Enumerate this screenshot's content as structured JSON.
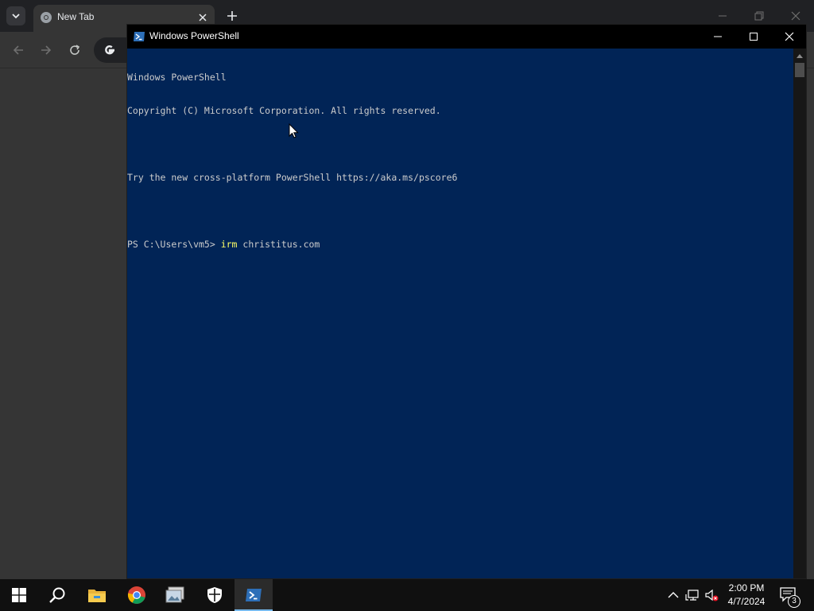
{
  "chrome": {
    "tab_title": "New Tab"
  },
  "powershell": {
    "window_title": "Windows PowerShell",
    "console_lines": [
      "Windows PowerShell",
      "Copyright (C) Microsoft Corporation. All rights reserved.",
      "",
      "Try the new cross-platform PowerShell https://aka.ms/pscore6",
      ""
    ],
    "prompt": "PS C:\\Users\\vm5> ",
    "command_keyword": "irm",
    "command_args": " christitus.com"
  },
  "taskbar": {
    "apps": [
      "start-icon",
      "search-icon",
      "file-explorer-icon",
      "chrome-icon",
      "photos-icon",
      "windows-security-icon",
      "powershell-icon"
    ],
    "active_app": "powershell-icon",
    "time": "2:00 PM",
    "date": "4/7/2024",
    "notification_count": "3"
  },
  "colors": {
    "console_bg": "#012456",
    "console_text": "#cccccc",
    "command_keyword": "#ffff66",
    "taskbar_bg": "#101010",
    "chrome_bg": "#353535"
  }
}
